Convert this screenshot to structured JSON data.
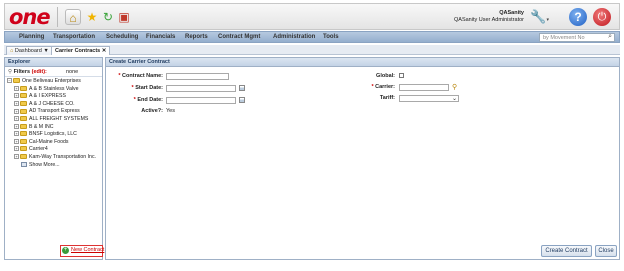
{
  "header": {
    "logo": "one",
    "user_name": "QASanity",
    "user_role": "QASanity User Administrator",
    "colors": {
      "brand": "#d0021b",
      "nav": "#a8bdd8"
    }
  },
  "nav": {
    "items": [
      "Planning",
      "Transportation",
      "Scheduling",
      "Financials",
      "Reports",
      "Contract Mgmt",
      "Administration",
      "Tools"
    ],
    "search_placeholder": "by Movement No"
  },
  "tabs": [
    {
      "label": "Dashboard",
      "suffix": "▼",
      "icon": "home-icon"
    },
    {
      "label": "Carrier Contracts",
      "suffix": "✕",
      "icon": "none"
    }
  ],
  "explorer": {
    "title": "Explorer",
    "filters_label": "Filters",
    "edit_label": "(edit):",
    "filters_value": "none",
    "root": "One Beliveau Enterprises",
    "children": [
      "A & B Stainless Valve",
      "A & I EXPRESS",
      "A & J CHEESE CO.",
      "AD Transport Express",
      "ALL FREIGHT SYSTEMS",
      "B & M INC",
      "BNSF Logistics, LLC",
      "Cal-Maine Foods",
      "Carrier4",
      "Kam-Way Transportation Inc."
    ],
    "show_more": "Show More...",
    "new_contract": "New Contract"
  },
  "form": {
    "title": "Create Carrier Contract",
    "contract_name_label": "Contract Name:",
    "start_date_label": "Start Date:",
    "end_date_label": "End Date:",
    "active_label": "Active?:",
    "active_value": "Yes",
    "global_label": "Global:",
    "carrier_label": "Carrier:",
    "tariff_label": "Tariff:",
    "required_mark": "*",
    "contract_name_value": "",
    "start_date_value": "",
    "end_date_value": "",
    "carrier_value": "",
    "tariff_value": ""
  },
  "buttons": {
    "create": "Create Contract",
    "close": "Close"
  }
}
